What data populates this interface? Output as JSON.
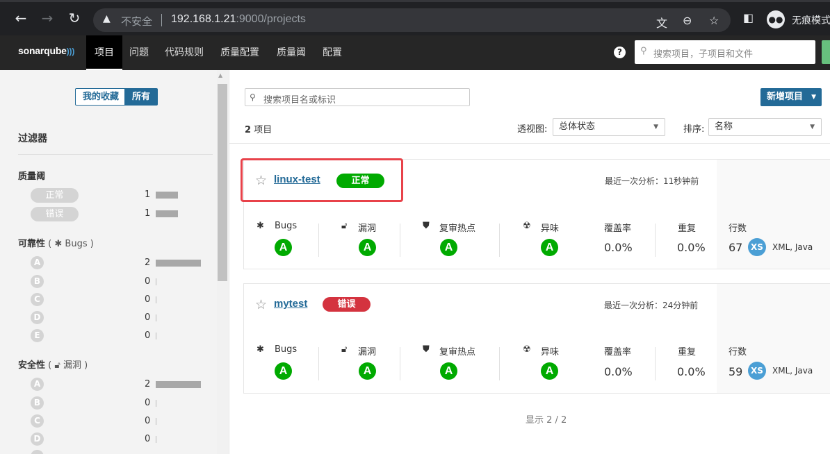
{
  "browser": {
    "insecure_label": "不安全",
    "url_host": "192.168.1.21",
    "url_path": ":9000/projects",
    "incognito_label": "无痕模式"
  },
  "nav": {
    "logo": "sonarqube",
    "items": [
      "项目",
      "问题",
      "代码规则",
      "质量配置",
      "质量阈",
      "配置"
    ],
    "search_placeholder": "搜索项目，子项目和文件"
  },
  "sidebar": {
    "toggle_fav": "我的收藏",
    "toggle_all": "所有",
    "filters_title": "过滤器",
    "quality_gate": {
      "title": "质量阈",
      "items": [
        {
          "label": "正常",
          "count": "1",
          "fraction": 0.5
        },
        {
          "label": "错误",
          "count": "1",
          "fraction": 0.5
        }
      ]
    },
    "reliability": {
      "title": "可靠性",
      "sub": "Bugs",
      "items": [
        {
          "label": "A",
          "count": "2",
          "fraction": 1
        },
        {
          "label": "B",
          "count": "0",
          "fraction": 0
        },
        {
          "label": "C",
          "count": "0",
          "fraction": 0
        },
        {
          "label": "D",
          "count": "0",
          "fraction": 0
        },
        {
          "label": "E",
          "count": "0",
          "fraction": 0
        }
      ]
    },
    "security": {
      "title": "安全性",
      "sub": "漏洞",
      "items": [
        {
          "label": "A",
          "count": "2",
          "fraction": 1
        },
        {
          "label": "B",
          "count": "0",
          "fraction": 0
        },
        {
          "label": "C",
          "count": "0",
          "fraction": 0
        },
        {
          "label": "D",
          "count": "0",
          "fraction": 0
        }
      ]
    }
  },
  "main": {
    "search_placeholder": "搜索项目名或标识",
    "new_project": "新增项目",
    "count": "2",
    "count_suffix": "项目",
    "perspective_label": "透视图:",
    "perspective_value": "总体状态",
    "sort_label": "排序:",
    "sort_value": "名称",
    "footer": "显示 2 / 2"
  },
  "metric_labels": {
    "bugs": "Bugs",
    "vulns": "漏洞",
    "hotspots": "复审热点",
    "smells": "异味",
    "coverage": "覆盖率",
    "dup": "重复",
    "lines": "行数"
  },
  "projects": [
    {
      "name": "linux-test",
      "status": "正常",
      "last_analysis": "最近一次分析：11秒钟前",
      "bugs": "A",
      "vulns": "A",
      "hotspots": "A",
      "smells": "A",
      "coverage": "0.0%",
      "dup": "0.0%",
      "lines": "67",
      "size": "XS",
      "langs": "XML, Java"
    },
    {
      "name": "mytest",
      "status": "错误",
      "last_analysis": "最近一次分析：24分钟前",
      "bugs": "A",
      "vulns": "A",
      "hotspots": "A",
      "smells": "A",
      "coverage": "0.0%",
      "dup": "0.0%",
      "lines": "59",
      "size": "XS",
      "langs": "XML, Java"
    }
  ]
}
